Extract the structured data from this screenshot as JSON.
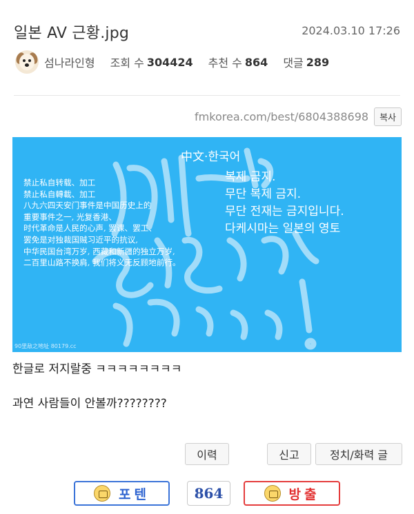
{
  "post": {
    "title": "일본 AV 근황.jpg",
    "date": "2024.03.10 17:26",
    "author": "섬나라인형",
    "views_label": "조회 수",
    "views": "304424",
    "recommend_label": "추천 수",
    "recommend": "864",
    "comments_label": "댓글",
    "comments": "289",
    "url": "fmkorea.com/best/6804388698",
    "copy_label": "복사"
  },
  "image": {
    "heading": "中文·한국어",
    "zh_lines": [
      "禁止私自转载、加工",
      "禁止私自轉載、加工",
      "八九六四天安门事件是中国历史上的",
      "重要事件之一, 光复香港、",
      "时代革命是人民的心声, 罢课、罢工、",
      "罢免是对独裁国贼习近平的抗议,",
      "中华民国台湾万岁, 西藏和新疆的独立万岁,",
      "二百里山路不换肩, 我们将义无反顾地前行。"
    ],
    "ko_lines": [
      "복제 금지.",
      "무단 복제 금지.",
      "무단 전재는 금지입니다.",
      "다케시마는 일본의 영토"
    ],
    "watermark_caption": "90里敌之地址 80179.cc"
  },
  "body": {
    "line1": "한글로 저지랄중 ㅋㅋㅋㅋㅋㅋㅋㅋ",
    "line2": "과연 사람들이 안볼까????????"
  },
  "actions": {
    "history": "이력",
    "report": "신고",
    "category": "정치/화력 글"
  },
  "votes": {
    "up_label": "포텐",
    "count": "864",
    "down_label": "방출"
  },
  "colors": {
    "image_bg": "#30b4f4",
    "vote_up": "#3a73d8",
    "vote_down": "#e43b3b"
  }
}
